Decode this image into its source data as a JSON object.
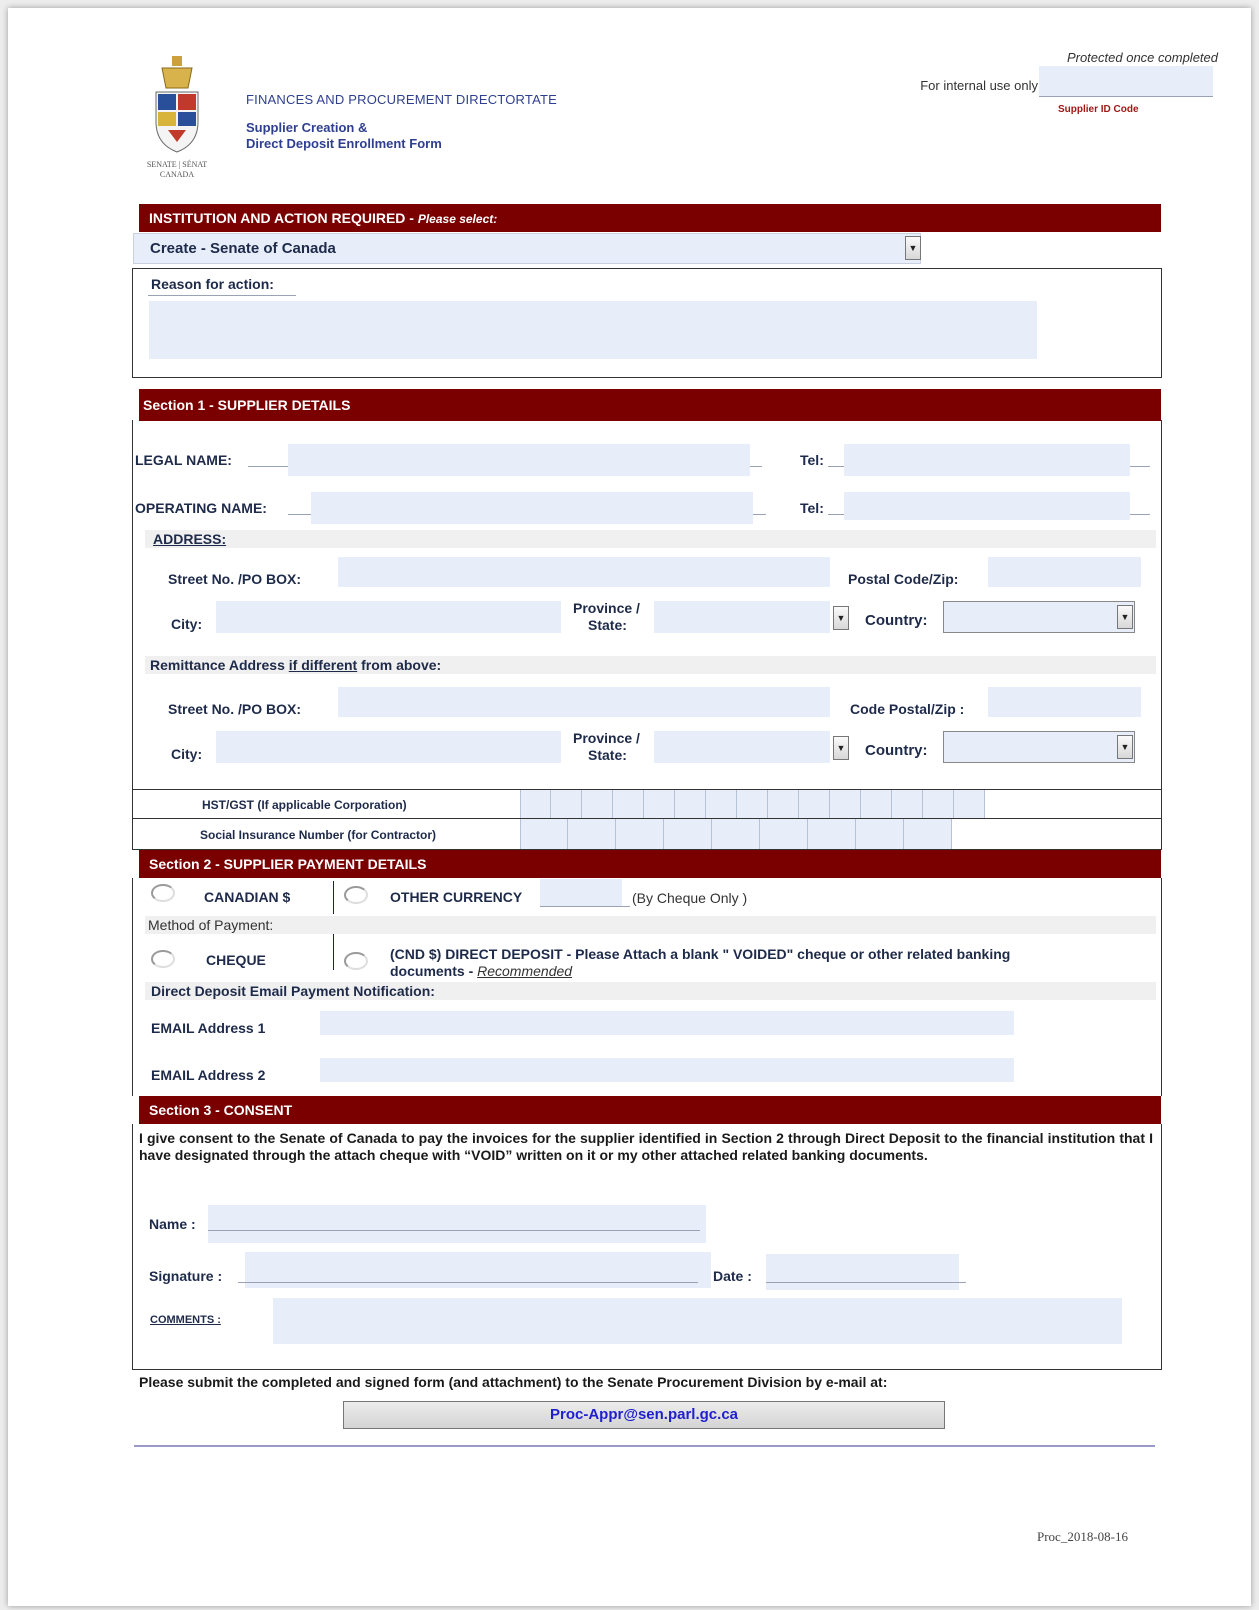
{
  "header": {
    "emblem_label": "SENATE | SÉNAT CANADA",
    "directorate": "FINANCES AND PROCUREMENT DIRECTORTATE",
    "form_title_line1": "Supplier Creation &",
    "form_title_line2": "Direct Deposit Enrollment Form",
    "protected_note": "Protected once completed",
    "internal_use": "For internal use only",
    "supplier_id_label": "Supplier ID Code"
  },
  "institution": {
    "band_title": "INSTITUTION  AND ACTION REQUIRED - ",
    "band_note": "Please select:",
    "selected_value": "Create - Senate of Canada",
    "reason_label": "Reason for action:"
  },
  "section1": {
    "title": "Section 1 - SUPPLIER DETAILS",
    "legal_name": "LEGAL NAME:",
    "operating_name": "OPERATING NAME:",
    "tel": "Tel:",
    "address": "ADDRESS:",
    "street": "Street No. /PO BOX:",
    "postal_code": "Postal Code/Zip:",
    "city": "City:",
    "province_line1": "Province /",
    "province_line2": "State:",
    "country": "Country:",
    "remit_before": "Remittance Address ",
    "remit_link": "if different",
    "remit_after": " from above:",
    "code_postal": "Code Postal/Zip :",
    "hst": "HST/GST (If applicable Corporation)",
    "sin": "Social Insurance Number (for Contractor)"
  },
  "section2": {
    "title": "Section 2 - SUPPLIER PAYMENT DETAILS",
    "canadian": "CANADIAN $",
    "other_currency": "OTHER CURRENCY",
    "by_cheque": "(By Cheque Only )",
    "method": "Method of Payment:",
    "cheque": "CHEQUE",
    "direct_deposit_line1": "(CND $) DIRECT DEPOSIT - Please Attach a blank \" VOIDED\" cheque or other related banking",
    "direct_deposit_line2": "documents - ",
    "recommended": "Recommended",
    "email_notification": "Direct Deposit Email Payment Notification:",
    "email1": "EMAIL Address 1",
    "email2": "EMAIL Address 2"
  },
  "section3": {
    "title": "Section 3 - CONSENT",
    "consent_text": "I give consent to the Senate of Canada to pay the invoices for the supplier identified in Section 2 through Direct Deposit to the financial institution that I have designated through the attach cheque with “VOID” written on it or my other attached related banking documents.",
    "name": "Name :",
    "signature": "Signature :",
    "date": "Date :",
    "comments": "COMMENTS :"
  },
  "footer": {
    "submit_note": "Please submit the completed and signed form (and attachment) to the Senate Procurement Division by e-mail at:",
    "email_button": "Proc-Appr@sen.parl.gc.ca",
    "version": "Proc_2018-08-16"
  },
  "colors": {
    "band": "#7a0000",
    "field": "#e7eefa",
    "link": "#1f1fd0"
  }
}
